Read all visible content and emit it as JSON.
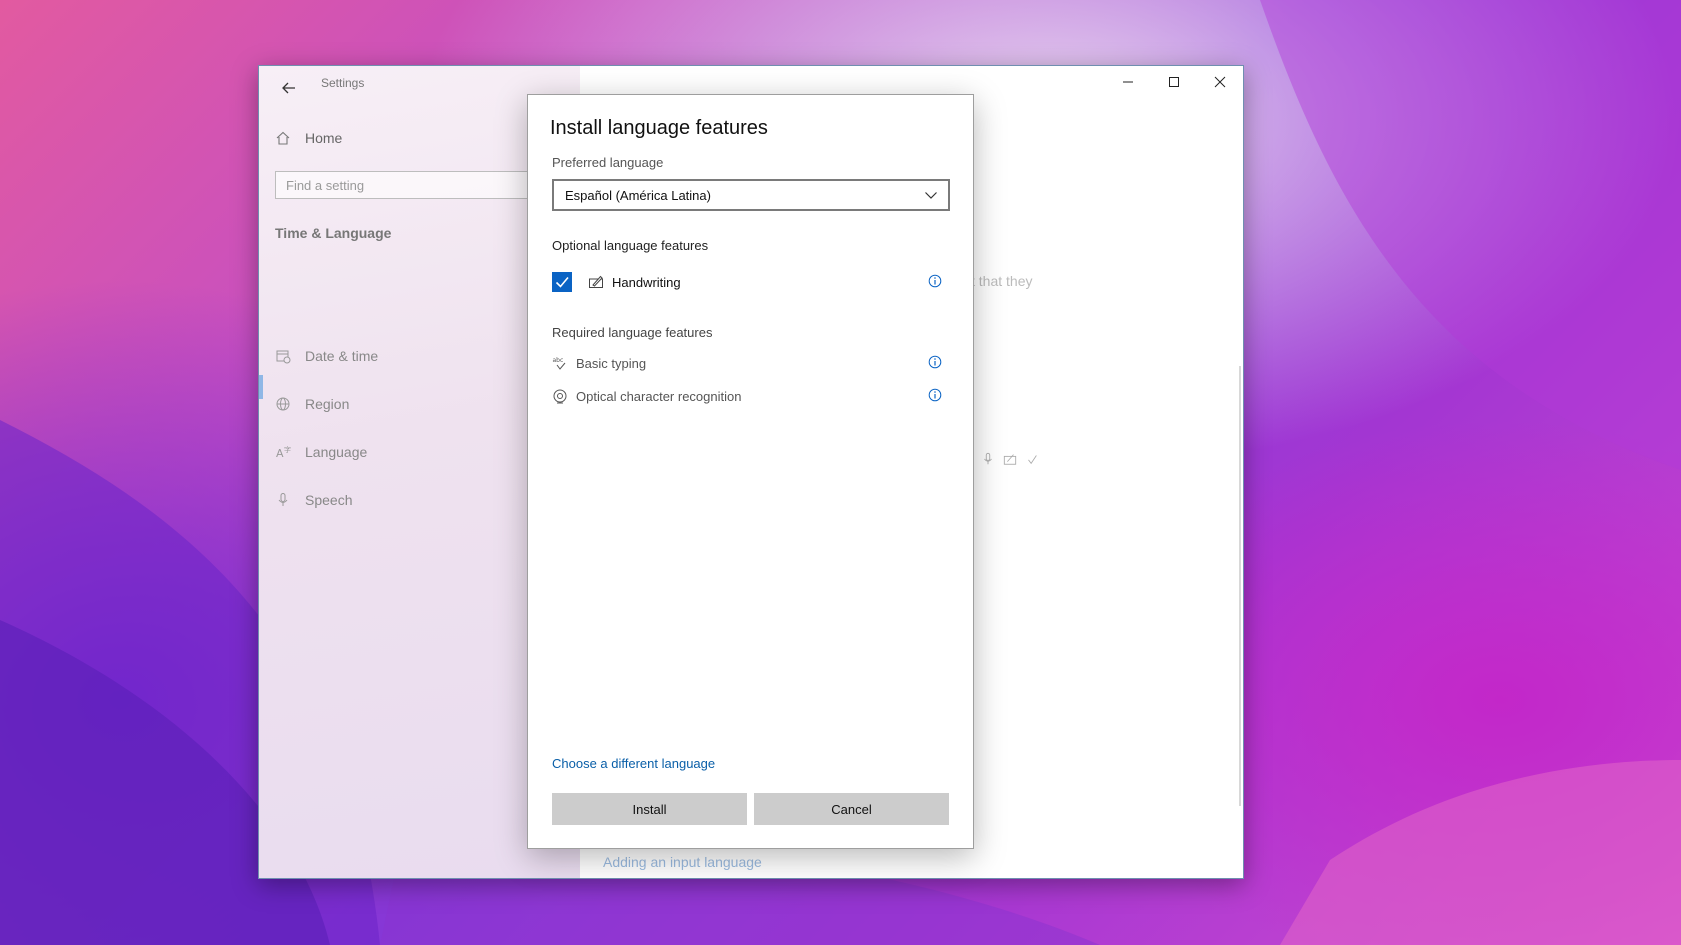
{
  "settings": {
    "app_title": "Settings",
    "nav": {
      "home_label": "Home",
      "search_placeholder": "Find a setting",
      "section_title": "Time & Language",
      "items": [
        {
          "label": "Date & time",
          "icon": "calendar-clock-icon"
        },
        {
          "label": "Region",
          "icon": "globe-icon"
        },
        {
          "label": "Language",
          "icon": "language-icon",
          "selected": true
        },
        {
          "label": "Speech",
          "icon": "microphone-icon"
        }
      ]
    },
    "background": {
      "partial_text": "t that they",
      "link": "Adding an input language"
    }
  },
  "dialog": {
    "title": "Install language features",
    "preferred_label": "Preferred language",
    "preferred_value": "Español (América Latina)",
    "optional_heading": "Optional language features",
    "optional_features": [
      {
        "label": "Handwriting",
        "checked": true,
        "icon": "handwriting-icon"
      }
    ],
    "required_heading": "Required language features",
    "required_features": [
      {
        "label": "Basic typing",
        "icon": "spellcheck-icon"
      },
      {
        "label": "Optical character recognition",
        "icon": "ocr-icon"
      }
    ],
    "link": "Choose a different language",
    "install_label": "Install",
    "cancel_label": "Cancel"
  },
  "colors": {
    "accent": "#0a63c4",
    "link": "#0a5fa8",
    "button": "#cccccc"
  }
}
